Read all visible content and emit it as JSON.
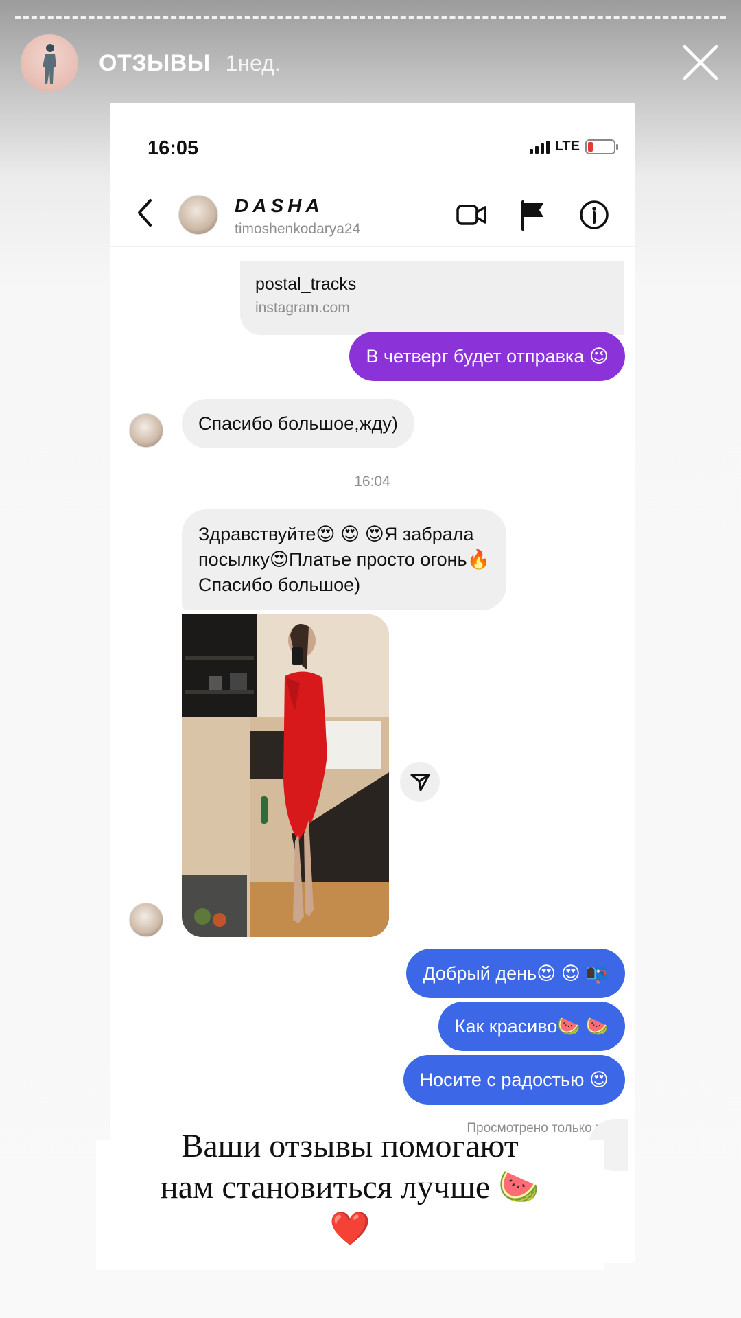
{
  "story": {
    "title": "ОТЗЫВЫ",
    "time_ago": "1нед.",
    "caption_line1": "Ваши отзывы помогают",
    "caption_line2": "нам становиться лучше 🍉",
    "caption_line3": "❤️"
  },
  "screenshot": {
    "status": {
      "time": "16:05",
      "network": "LTE"
    },
    "chat": {
      "name": "DASHA",
      "handle": "timoshenkodarya24"
    },
    "link_preview": {
      "title": "postal_tracks",
      "url": "instagram.com"
    },
    "messages": [
      {
        "side": "out",
        "text": "В четверг будет отправка 😉"
      },
      {
        "side": "in",
        "text": "Спасибо большое,жду)"
      },
      {
        "side": "in",
        "lines": [
          "Здравствуйте😍 😍 😍Я забрала",
          "посылку😍Платье просто огонь🔥",
          "Спасибо большое)"
        ]
      },
      {
        "side": "out",
        "text": "Добрый день😍 😍 📭"
      },
      {
        "side": "out",
        "text": "Как красиво🍉 🍉"
      },
      {
        "side": "out",
        "text": "Носите с радостью 😍"
      }
    ],
    "timestamp": "16:04",
    "seen_status": "Просмотрено только что"
  },
  "colors": {
    "outgoing_purple": "#8b33d9",
    "outgoing_blue": "#3c68e8",
    "incoming_gray": "#efefef"
  }
}
